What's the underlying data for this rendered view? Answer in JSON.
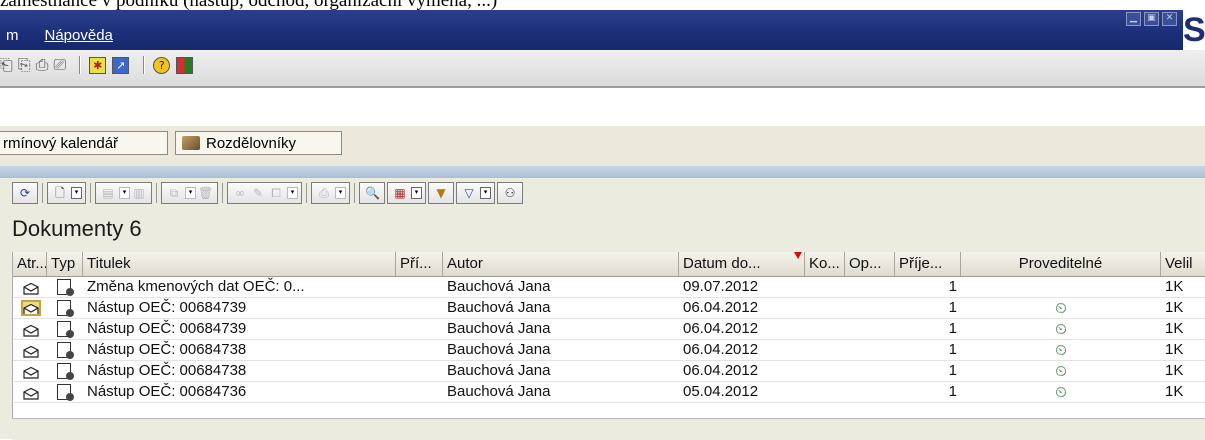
{
  "caption": "zaměstnance v podniku (nástup, odchod, organizační výměna, ...)",
  "menu": {
    "items": [
      {
        "label": "m"
      },
      {
        "label": "Nápověda"
      }
    ]
  },
  "window_buttons": [
    "minimize",
    "maximize",
    "close"
  ],
  "brand_letter": "S",
  "tabs": [
    {
      "label": "rmínový kalendář"
    },
    {
      "label": "Rozdělovníky"
    }
  ],
  "table": {
    "title": "Dokumenty 6",
    "columns": [
      "Atr...",
      "Typ",
      "Titulek",
      "Pří...",
      "Autor",
      "Datum do...",
      "Ko...",
      "Op...",
      "Příje...",
      "Proveditelné",
      "Velil"
    ],
    "sorted_column": "Datum do...",
    "rows": [
      {
        "titulek": "Změna kmenových dat OEČ: 0...",
        "autor": "Bauchová Jana",
        "datum": "09.07.2012",
        "prijemci": "1",
        "proveditelne": "",
        "velikost": "1K"
      },
      {
        "titulek": "Nástup OEČ: 00684739",
        "autor": "Bauchová Jana",
        "datum": "06.04.2012",
        "prijemci": "1",
        "proveditelne": "⏲",
        "velikost": "1K"
      },
      {
        "titulek": "Nástup OEČ: 00684739",
        "autor": "Bauchová Jana",
        "datum": "06.04.2012",
        "prijemci": "1",
        "proveditelne": "⏲",
        "velikost": "1K"
      },
      {
        "titulek": "Nástup OEČ: 00684738",
        "autor": "Bauchová Jana",
        "datum": "06.04.2012",
        "prijemci": "1",
        "proveditelne": "⏲",
        "velikost": "1K"
      },
      {
        "titulek": "Nástup OEČ: 00684738",
        "autor": "Bauchová Jana",
        "datum": "06.04.2012",
        "prijemci": "1",
        "proveditelne": "⏲",
        "velikost": "1K"
      },
      {
        "titulek": "Nástup OEČ: 00684736",
        "autor": "Bauchová Jana",
        "datum": "05.04.2012",
        "prijemci": "1",
        "proveditelne": "⏲",
        "velikost": "1K"
      }
    ],
    "selected_row": 1
  },
  "colors": {
    "titlebar": "#1c2e78",
    "panel": "#ecebe0",
    "band": "#b6c9dc",
    "sort_marker": "#d01010"
  }
}
